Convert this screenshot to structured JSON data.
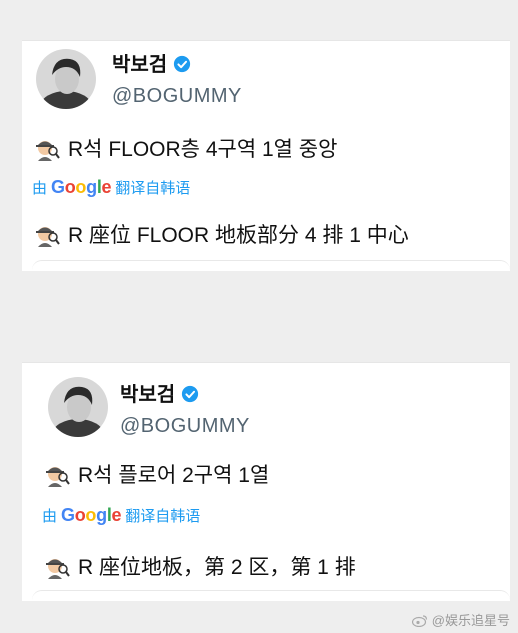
{
  "tweets": [
    {
      "display_name": "박보검",
      "handle": "@BOGUMMY",
      "original_text": "R석 FLOOR층 4구역 1열 중앙",
      "translate_by": "由",
      "translate_from": "翻译自韩语",
      "translated_text": "R 座位 FLOOR 地板部分 4 排 1 中心"
    },
    {
      "display_name": "박보검",
      "handle": "@BOGUMMY",
      "original_text": "R석 플로어 2구역 1열",
      "translate_by": "由",
      "translate_from": "翻译自韩语",
      "translated_text": "R 座位地板，第 2 区，第 1 排"
    }
  ],
  "google_logo": {
    "letters": [
      "G",
      "o",
      "o",
      "g",
      "l",
      "e"
    ]
  },
  "watermark": "@娱乐追星号",
  "colors": {
    "accent": "#1d9bf0",
    "handle": "#536471",
    "background": "#eeeeee"
  }
}
